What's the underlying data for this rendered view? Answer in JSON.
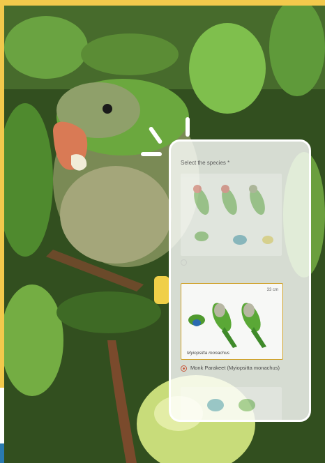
{
  "question": {
    "label": "Select the species *"
  },
  "options": [
    {
      "label": "Monk Parakeet (Myiopsitta monachus)",
      "selected": true,
      "card_scale": "33 cm",
      "card_caption": "Myiopsitta monachus"
    }
  ],
  "colors": {
    "accent": "#c85a3e",
    "highlight": "#cfa128",
    "background_border": "#f2c94c"
  }
}
